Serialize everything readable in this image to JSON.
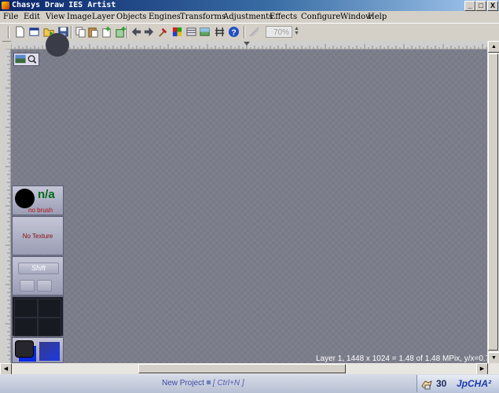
{
  "window": {
    "title": "Chasys Draw IES Artist",
    "minimize_glyph": "_",
    "maximize_glyph": "□",
    "close_glyph": "X"
  },
  "menu": [
    "File",
    "Edit",
    "View",
    "Image",
    "Layer",
    "Objects",
    "Engines",
    "Transforms",
    "Adjustments",
    "Effects",
    "Configure",
    "Window",
    "Help"
  ],
  "toolbar": {
    "icons": [
      "new-document-icon",
      "new-window-icon",
      "open-folder-icon",
      "save-icon",
      "copy-icon",
      "paste-icon",
      "paste-new-icon",
      "add-layer-icon",
      "arrow-left-icon",
      "arrow-right-icon",
      "hammer-icon",
      "palette-icon",
      "layers-icon",
      "image-icon",
      "tools-icon",
      "help-icon"
    ],
    "zoom": "70%"
  },
  "tool_panel": {
    "brush_label": "n/a",
    "brush_sub": "no brush",
    "texture_label": "No Texture",
    "shift_label": "Shift"
  },
  "canvas": {
    "info": "Layer 1, 1448 x 1024 = 1.48 of 1.48 MPix, y/x=0.7071"
  },
  "status": {
    "new_project": "New Project",
    "shortcut": "[ Ctrl+N ]",
    "count": "30",
    "brand": "JpCHA²"
  },
  "colors": {
    "title_gradient_start": "#0a246a",
    "canvas_bg": "#777a87",
    "status_bg": "#c8d0e0"
  }
}
